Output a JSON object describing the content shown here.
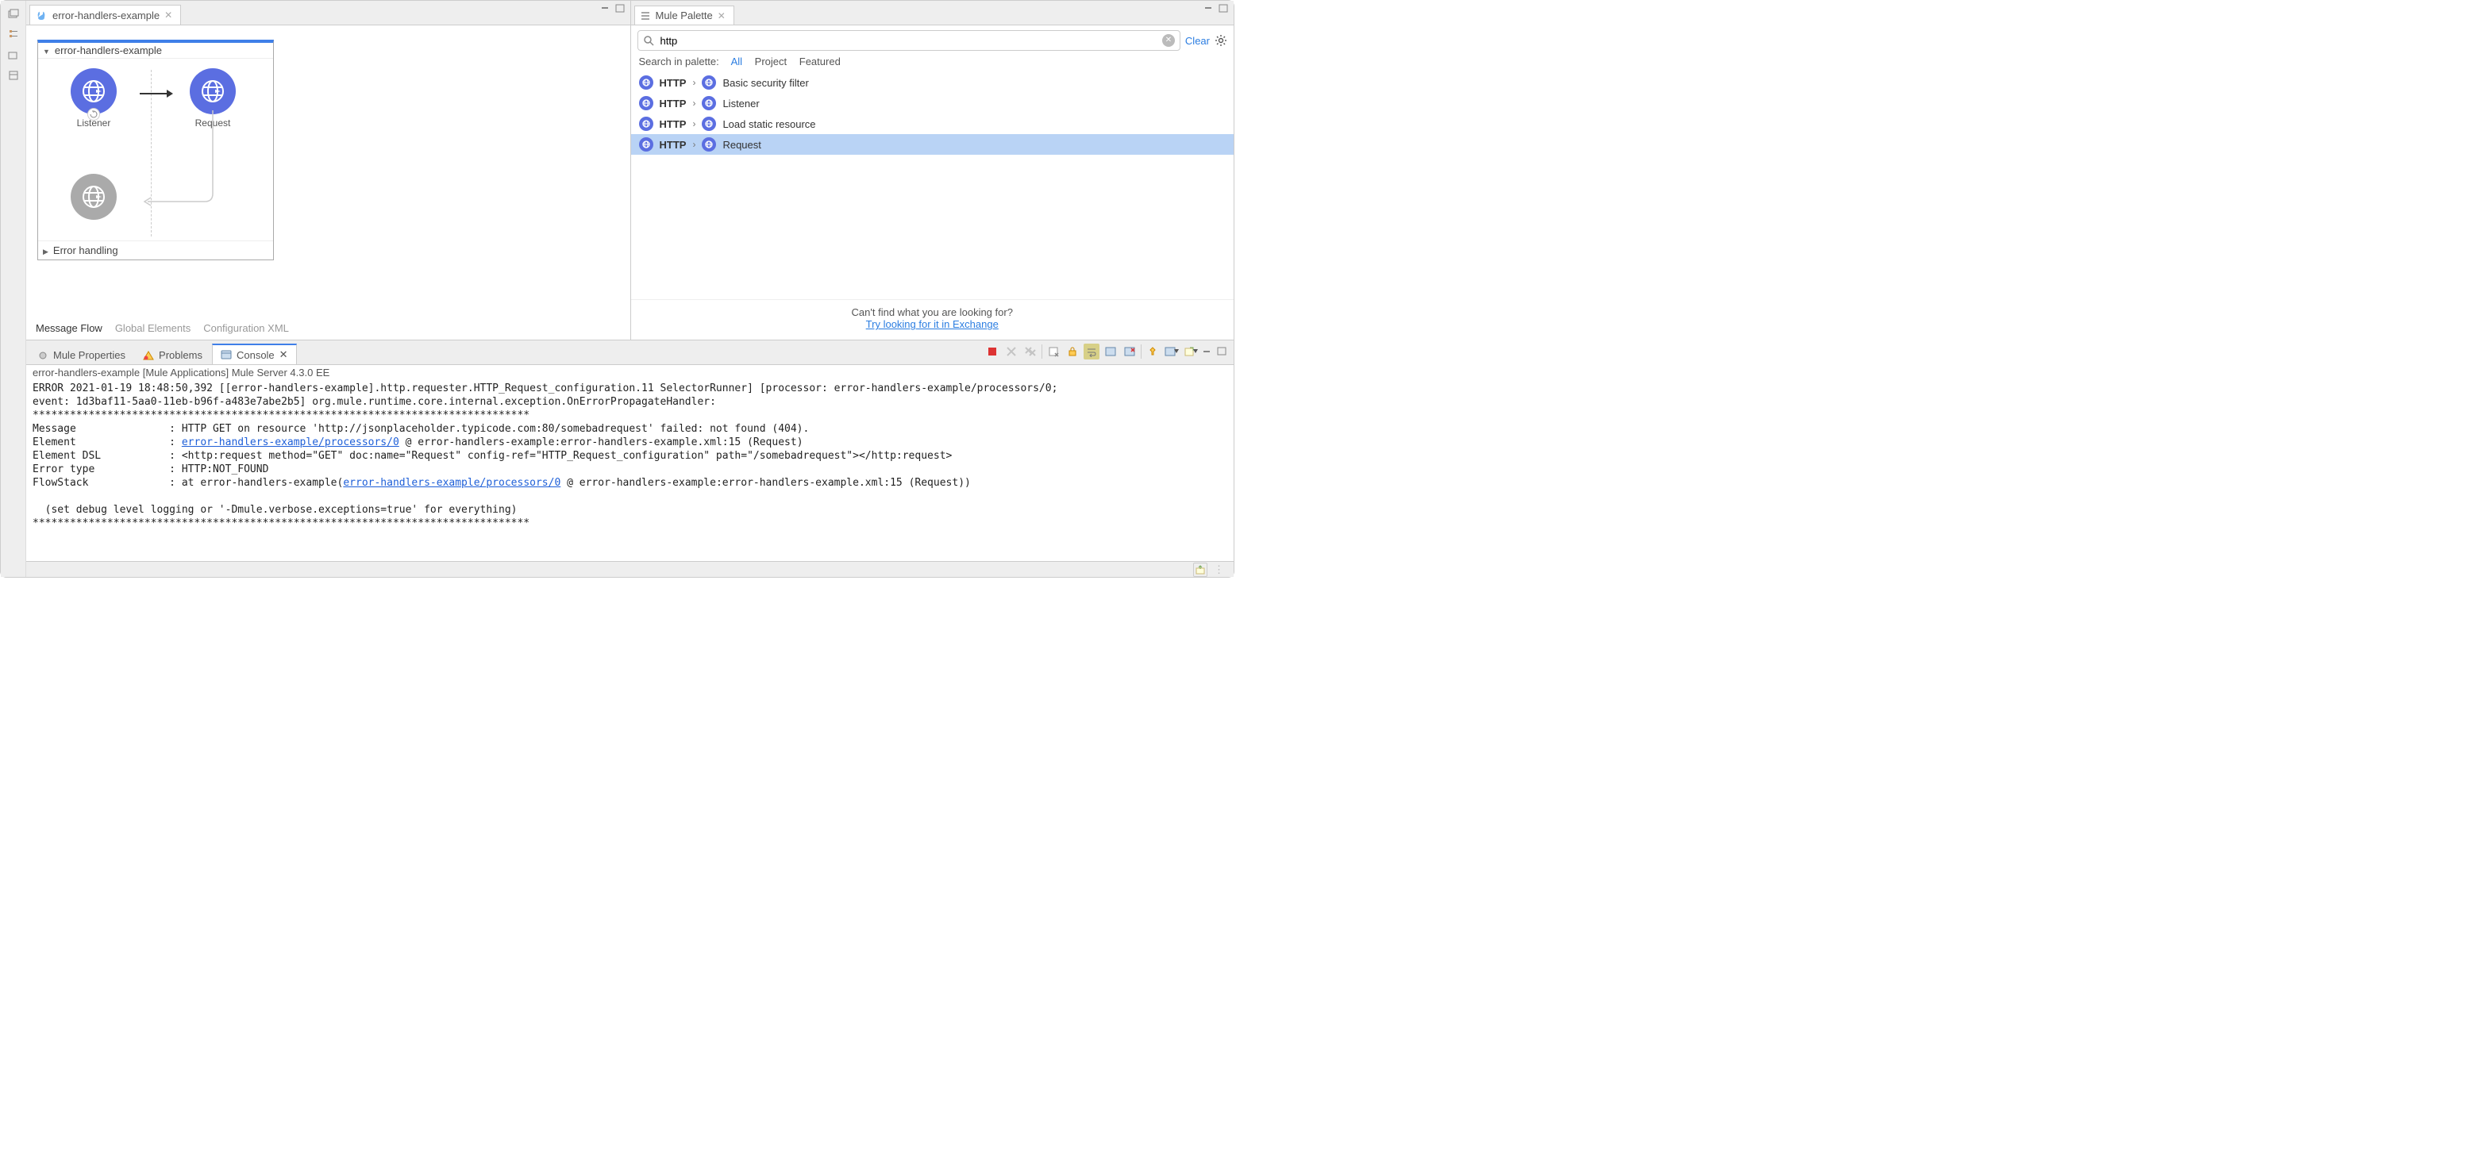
{
  "editor": {
    "tab_label": "error-handlers-example",
    "flow_name": "error-handlers-example",
    "components": {
      "listener_label": "Listener",
      "request_label": "Request"
    },
    "error_handling_label": "Error handling",
    "bottom_tabs": {
      "message_flow": "Message Flow",
      "global_elements": "Global Elements",
      "configuration_xml": "Configuration XML"
    }
  },
  "palette": {
    "tab_label": "Mule Palette",
    "search_value": "http",
    "clear_label": "Clear",
    "filter_prefix": "Search in palette:",
    "filter_all": "All",
    "filter_project": "Project",
    "filter_featured": "Featured",
    "items": [
      {
        "conn": "HTTP",
        "op": "Basic security filter",
        "selected": false
      },
      {
        "conn": "HTTP",
        "op": "Listener",
        "selected": false
      },
      {
        "conn": "HTTP",
        "op": "Load static resource",
        "selected": false
      },
      {
        "conn": "HTTP",
        "op": "Request",
        "selected": true
      }
    ],
    "footer_text": "Can't find what you are looking for?",
    "footer_link": "Try looking for it in Exchange"
  },
  "console": {
    "tabs": {
      "mule_properties": "Mule Properties",
      "problems": "Problems",
      "console": "Console"
    },
    "title": "error-handlers-example [Mule Applications] Mule Server 4.3.0 EE",
    "l1a": "ERROR 2021-01-19 18:48:50,392 [[error-handlers-example].http.requester.HTTP_Request_configuration.11 SelectorRunner] [processor: error-handlers-example/processors/0; ",
    "l1b": "event: 1d3baf11-5aa0-11eb-b96f-a483e7abe2b5] org.mule.runtime.core.internal.exception.OnErrorPropagateHandler: ",
    "stars1": "********************************************************************************",
    "msg": "Message               : HTTP GET on resource 'http://jsonplaceholder.typicode.com:80/somebadrequest' failed: not found (404).",
    "el_p": "Element               : ",
    "el_link": "error-handlers-example/processors/0",
    "el_s": " @ error-handlers-example:error-handlers-example.xml:15 (Request)",
    "dsl": "Element DSL           : <http:request method=\"GET\" doc:name=\"Request\" config-ref=\"HTTP_Request_configuration\" path=\"/somebadrequest\"></http:request>",
    "etype": "Error type            : HTTP:NOT_FOUND",
    "fs_p": "FlowStack             : at error-handlers-example(",
    "fs_link": "error-handlers-example/processors/0",
    "fs_s": " @ error-handlers-example:error-handlers-example.xml:15 (Request))",
    "debug": "  (set debug level logging or '-Dmule.verbose.exceptions=true' for everything)",
    "stars2": "********************************************************************************"
  }
}
